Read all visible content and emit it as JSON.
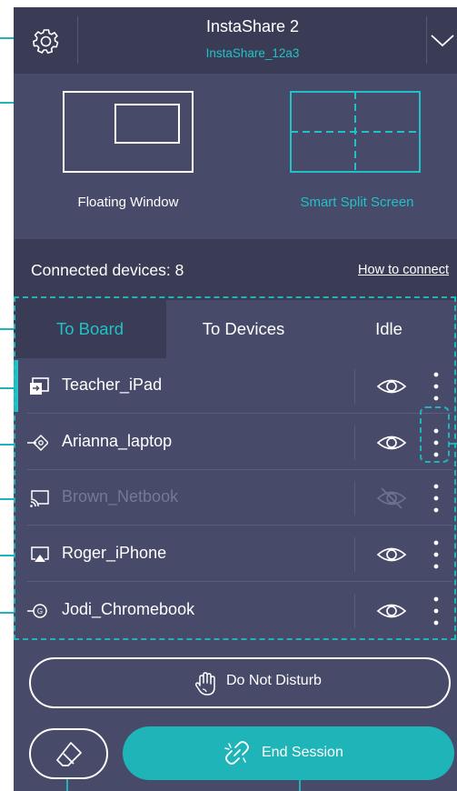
{
  "app": {
    "title": "InstaShare 2",
    "subtitle": "InstaShare_12a3",
    "settings_icon": "gear-icon",
    "expand_icon": "chevron-down-icon"
  },
  "modes": [
    {
      "label": "Floating Window",
      "icon": "floating-window-icon",
      "active": false
    },
    {
      "label": "Smart Split Screen",
      "icon": "split-screen-icon",
      "active": true
    }
  ],
  "connected": {
    "label": "Connected devices: 8",
    "help_link": "How to connect"
  },
  "tabs": [
    {
      "label": "To Board",
      "active": true
    },
    {
      "label": "To Devices",
      "active": false
    },
    {
      "label": "Idle",
      "active": false
    }
  ],
  "devices": [
    {
      "name": "Teacher_iPad",
      "icon": "screen-share-icon",
      "visible": true,
      "dimmed": false,
      "active": true
    },
    {
      "name": "Arianna_laptop",
      "icon": "laptop-app-icon",
      "visible": true,
      "dimmed": false,
      "active": false
    },
    {
      "name": "Brown_Netbook",
      "icon": "cast-icon",
      "visible": false,
      "dimmed": true,
      "active": false
    },
    {
      "name": "Roger_iPhone",
      "icon": "airplay-icon",
      "visible": true,
      "dimmed": false,
      "active": false
    },
    {
      "name": "Jodi_Chromebook",
      "icon": "google-cast-icon",
      "visible": true,
      "dimmed": false,
      "active": false
    }
  ],
  "actions": {
    "dnd_label": "Do Not Disturb",
    "end_label": "End Session",
    "eraser_icon": "eraser-icon"
  },
  "colors": {
    "accent": "#1fb5b8",
    "panel": "#474a68",
    "panel_dark": "#3a3c56"
  }
}
